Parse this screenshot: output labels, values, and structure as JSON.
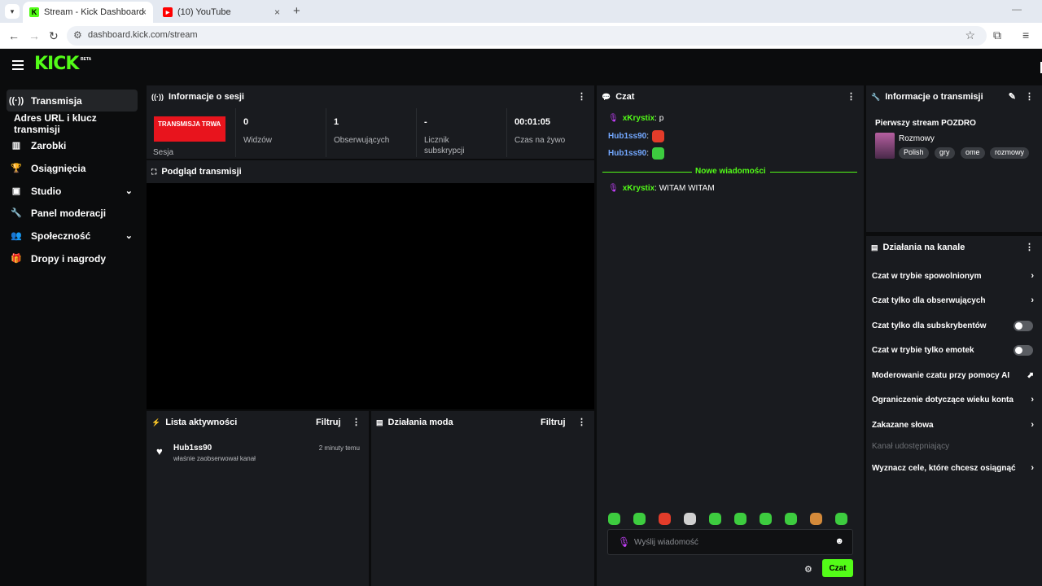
{
  "browser": {
    "tabs": [
      {
        "title": "Stream - Kick Dashboard"
      },
      {
        "title": "(10) YouTube"
      }
    ],
    "url": "dashboard.kick.com/stream"
  },
  "header": {
    "logo": "KICK",
    "beta": "BETA"
  },
  "sidebar": {
    "items": [
      {
        "label": "Transmisja"
      },
      {
        "label": "Adres URL i klucz transmisji"
      },
      {
        "label": "Zarobki"
      },
      {
        "label": "Osiągnięcia"
      },
      {
        "label": "Studio"
      },
      {
        "label": "Panel moderacji"
      },
      {
        "label": "Społeczność"
      },
      {
        "label": "Dropy i nagrody"
      }
    ]
  },
  "session": {
    "title": "Informacje o sesji",
    "live_badge": "TRANSMISJA TRWA",
    "session_label": "Sesja",
    "stats": [
      {
        "value": "0",
        "label": "Widzów"
      },
      {
        "value": "1",
        "label": "Obserwujących"
      },
      {
        "value": "-",
        "label": "Licznik subskrypcji"
      },
      {
        "value": "00:01:05",
        "label": "Czas na żywo"
      }
    ]
  },
  "preview": {
    "title": "Podgląd transmisji"
  },
  "activity": {
    "title": "Lista aktywności",
    "filter": "Filtruj",
    "items": [
      {
        "user": "Hub1ss90",
        "desc": "właśnie zaobserwował kanał",
        "time": "2 minuty temu"
      }
    ]
  },
  "mod_actions": {
    "title": "Działania moda",
    "filter": "Filtruj"
  },
  "chat": {
    "title": "Czat",
    "messages": [
      {
        "user": "xKrystix",
        "text": ": p"
      },
      {
        "user": "Hub1ss90",
        "text": ":"
      },
      {
        "user": "Hub1ss90",
        "text": ":"
      },
      {
        "user": "xKrystix",
        "text": ": WITAM WITAM"
      }
    ],
    "new_messages": "Nowe wiadomości",
    "input_placeholder": "Wyślij wiadomość",
    "send": "Czat"
  },
  "stream_info": {
    "title": "Informacje o transmisji",
    "stream_title": "Pierwszy stream POZDRO",
    "category": "Rozmowy",
    "tags": [
      "Polish",
      "gry",
      "ome",
      "rozmowy"
    ]
  },
  "channel_actions": {
    "title": "Działania na kanale",
    "rows": [
      {
        "label": "Czat w trybie spowolnionym"
      },
      {
        "label": "Czat tylko dla obserwujących"
      },
      {
        "label": "Czat tylko dla subskrybentów"
      },
      {
        "label": "Czat w trybie tylko emotek"
      },
      {
        "label": "Moderowanie czatu przy pomocy AI"
      },
      {
        "label": "Ograniczenie dotyczące wieku konta"
      },
      {
        "label": "Zakazane słowa"
      },
      {
        "label": "Kanał udostępniający"
      },
      {
        "label": "Wyznacz cele, które chcesz osiągnąć"
      }
    ]
  },
  "colors": {
    "accent": "#53fc18",
    "live": "#e8141d",
    "panel": "#191b1f"
  }
}
